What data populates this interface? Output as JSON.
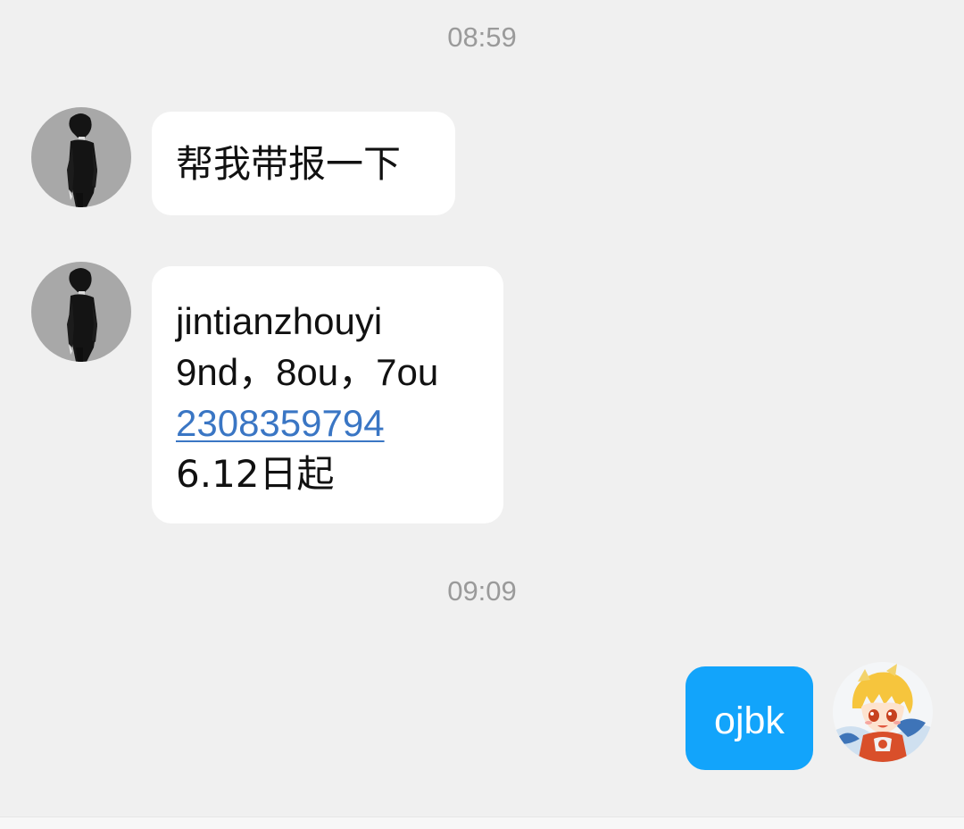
{
  "timestamps": {
    "first": "08:59",
    "second": "09:09"
  },
  "messages": [
    {
      "sender": "contact",
      "avatar_icon": "boy-silhouette-avatar-icon",
      "lines": [
        "帮我带报一下"
      ]
    },
    {
      "sender": "contact",
      "avatar_icon": "boy-silhouette-avatar-icon",
      "lines": [
        "jintianzhouyi",
        "9nd，8ou，7ou",
        "2308359794",
        "6.12日起"
      ],
      "link_line_index": 2
    },
    {
      "sender": "self",
      "avatar_icon": "anime-character-avatar-icon",
      "lines": [
        "ojbk"
      ]
    }
  ],
  "colors": {
    "background": "#f0f0f0",
    "contact_bubble": "#ffffff",
    "self_bubble": "#12a4fb",
    "link": "#3a76c4",
    "timestamp": "#9a9a9a"
  }
}
